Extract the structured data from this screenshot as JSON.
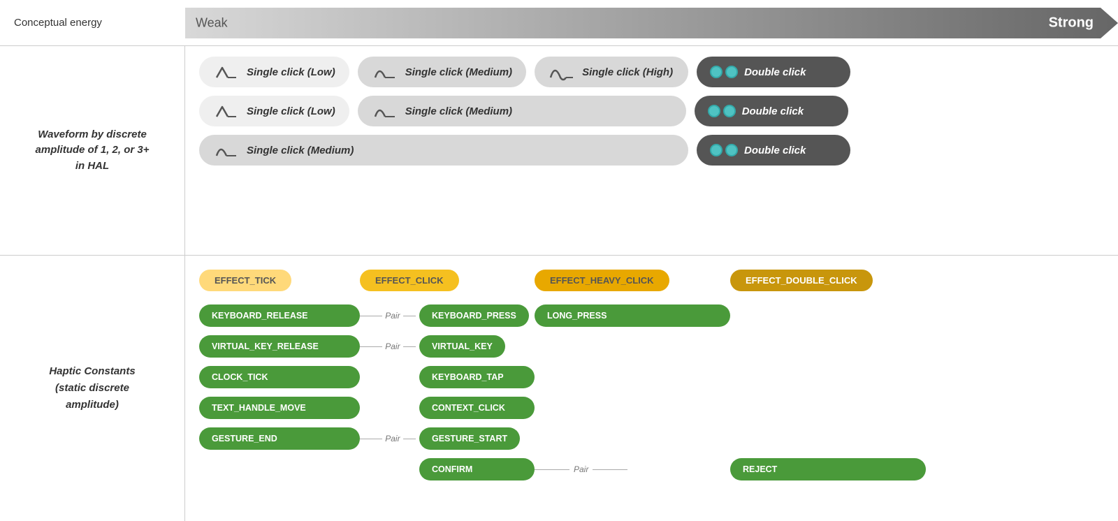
{
  "left": {
    "conceptual_energy_label": "Conceptual energy",
    "waveform_label": "Waveform by discrete\namplitude of 1, 2, or 3+\nin HAL",
    "haptic_label": "Haptic Constants\n(static discrete\namplitude)"
  },
  "energy": {
    "weak_label": "Weak",
    "strong_label": "Strong"
  },
  "waveform_rows": [
    {
      "items": [
        {
          "type": "light",
          "icon": "low-wave",
          "label": "Single click (Low)"
        },
        {
          "type": "medium",
          "icon": "medium-wave",
          "label": "Single click (Medium)"
        },
        {
          "type": "medium",
          "icon": "high-wave",
          "label": "Single click (High)"
        },
        {
          "type": "dark",
          "icon": "double-dots",
          "label": "Double click"
        }
      ]
    },
    {
      "items": [
        {
          "type": "light",
          "icon": "low-wave",
          "label": "Single click (Low)"
        },
        {
          "type": "medium",
          "icon": "medium-wave",
          "label": "Single click (Medium)"
        },
        {
          "type": "dark",
          "icon": "double-dots",
          "label": "Double click"
        }
      ]
    },
    {
      "items": [
        {
          "type": "medium",
          "icon": "medium-wave",
          "label": "Single click (Medium)"
        },
        {
          "type": "dark",
          "icon": "double-dots",
          "label": "Double click"
        }
      ]
    }
  ],
  "effects": {
    "tick": "EFFECT_TICK",
    "click": "EFFECT_CLICK",
    "heavy_click": "EFFECT_HEAVY_CLICK",
    "double_click": "EFFECT_DOUBLE_CLICK"
  },
  "constants": {
    "col1": [
      "KEYBOARD_RELEASE",
      "VIRTUAL_KEY_RELEASE",
      "CLOCK_TICK",
      "TEXT_HANDLE_MOVE",
      "GESTURE_END"
    ],
    "col2": [
      "KEYBOARD_PRESS",
      "VIRTUAL_KEY",
      "KEYBOARD_TAP",
      "CONTEXT_CLICK",
      "GESTURE_START",
      "CONFIRM"
    ],
    "col3": [
      "LONG_PRESS"
    ],
    "col4": [
      "REJECT"
    ],
    "pair_labels": {
      "keyboard": "Pair",
      "virtual_key": "Pair",
      "gesture": "Pair",
      "confirm_reject": "Pair"
    }
  }
}
